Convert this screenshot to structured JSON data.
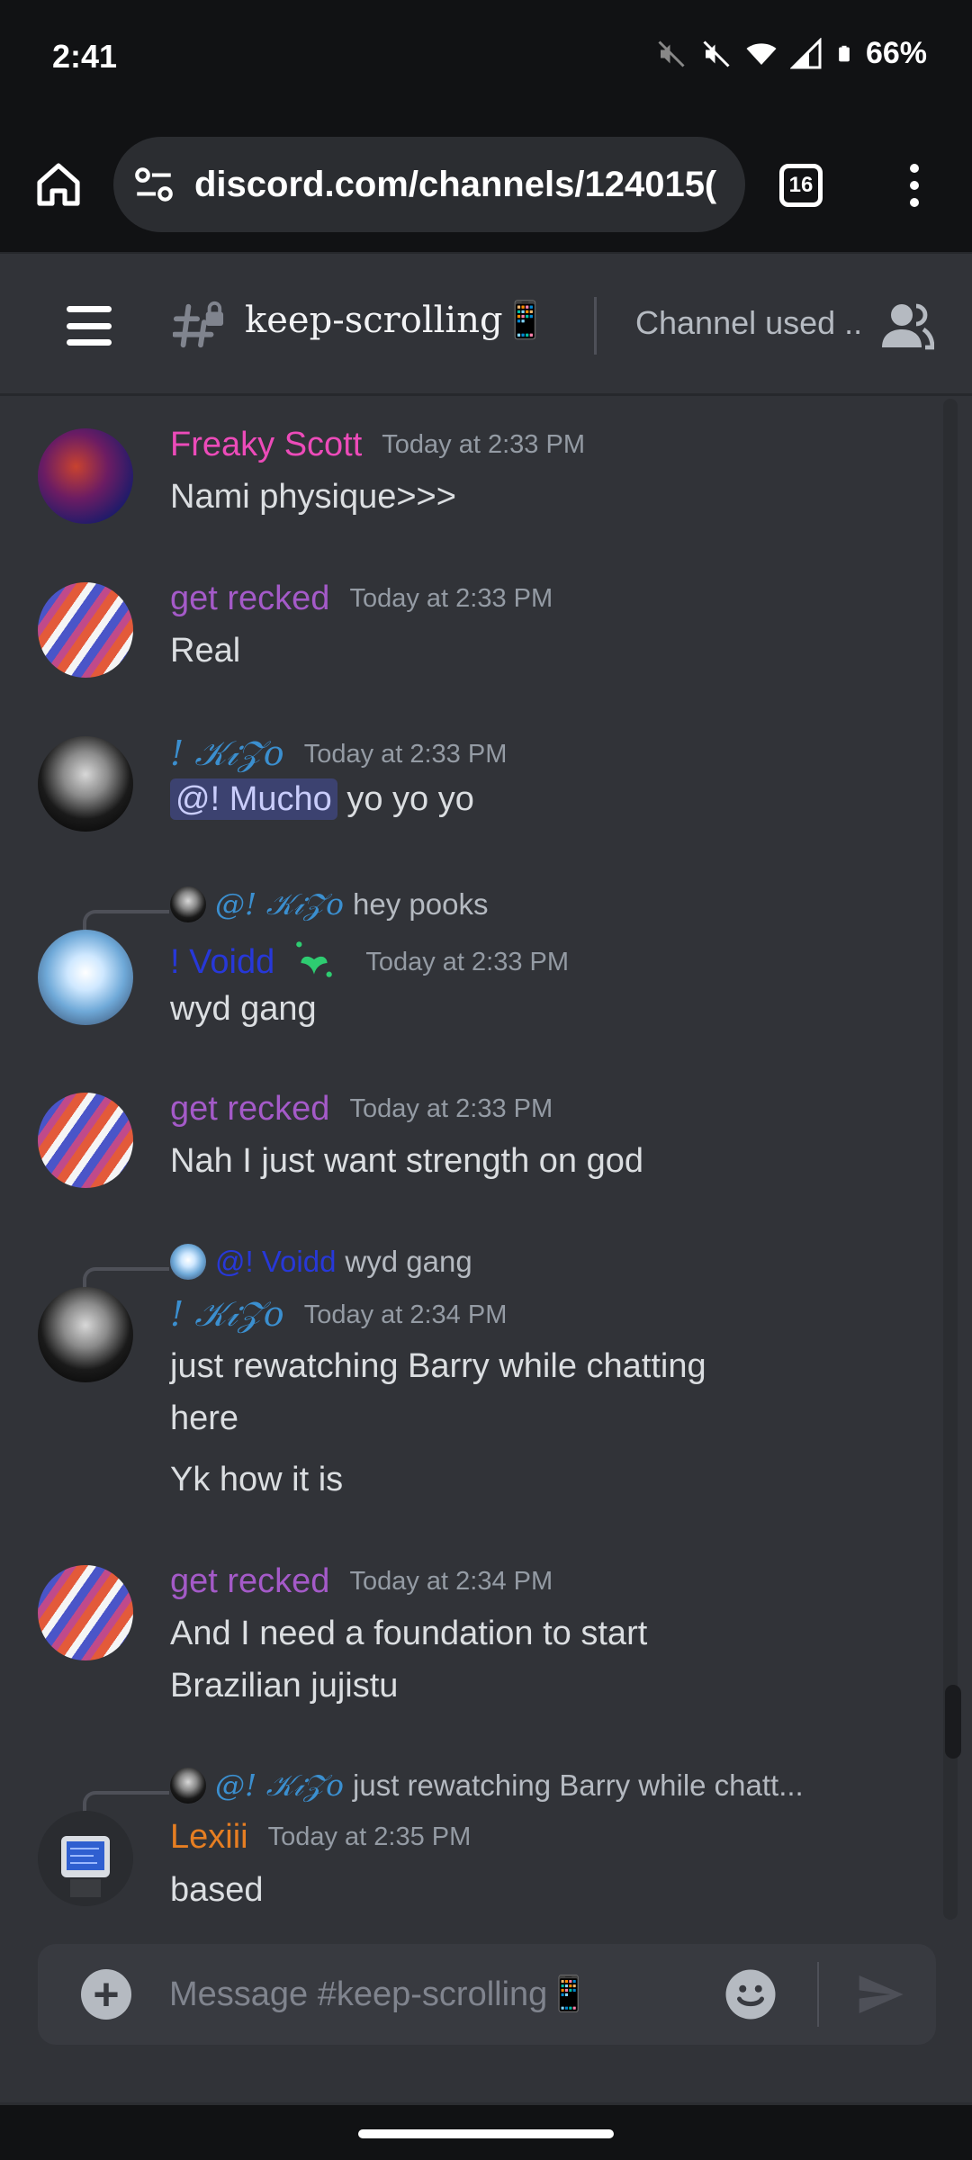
{
  "status_bar": {
    "time": "2:41",
    "battery": "66%"
  },
  "browser": {
    "url": "discord.com/channels/124015(",
    "tab_count": "16"
  },
  "channel": {
    "name": "keep-scrolling📱",
    "topic": "Channel used ..."
  },
  "messages": [
    {
      "author": "Freaky Scott",
      "author_color": "#ec4bb9",
      "timestamp": "Today at 2:33 PM",
      "lines": [
        "Nami physique>>>"
      ]
    },
    {
      "author": "get recked",
      "author_color": "#a45ac8",
      "timestamp": "Today at 2:33 PM",
      "lines": [
        "Real"
      ]
    },
    {
      "author": "! 𝒦𝒾𝒵𝑜",
      "author_color": "#3b8fcf",
      "timestamp": "Today at 2:33 PM",
      "mention": "@! Mucho",
      "lines": [
        "yo yo yo"
      ]
    },
    {
      "reply_to": "@! 𝒦𝒾𝒵𝑜",
      "reply_color": "#3b8fcf",
      "reply_text": "hey pooks",
      "author": "! Voidd",
      "author_color": "#2738d8",
      "timestamp": "Today at 2:33 PM",
      "lines": [
        "wyd gang"
      ]
    },
    {
      "author": "get recked",
      "author_color": "#a45ac8",
      "timestamp": "Today at 2:33 PM",
      "lines": [
        "Nah I just want strength on god"
      ]
    },
    {
      "reply_to": "@! Voidd",
      "reply_color": "#2738d8",
      "reply_text": "wyd gang",
      "author": "! 𝒦𝒾𝒵𝑜",
      "author_color": "#3b8fcf",
      "timestamp": "Today at 2:34 PM",
      "lines": [
        "just rewatching Barry while chatting",
        "here",
        "Yk how it is"
      ]
    },
    {
      "author": "get recked",
      "author_color": "#a45ac8",
      "timestamp": "Today at 2:34 PM",
      "lines": [
        "And I need a foundation to start",
        "Brazilian jujistu"
      ]
    },
    {
      "reply_to": "@! 𝒦𝒾𝒵𝑜",
      "reply_color": "#3b8fcf",
      "reply_text": "just rewatching Barry while chatt...",
      "author": "Lexiii",
      "author_color": "#e67e22",
      "timestamp": "Today at 2:35 PM",
      "lines": [
        "based"
      ]
    }
  ],
  "composer": {
    "placeholder": "Message #keep-scrolling📱"
  },
  "icons": {
    "home": "home-icon",
    "site_settings": "site-settings-icon",
    "tabs": "tabs-icon",
    "overflow": "more-vert-icon",
    "hamburger": "hamburger-icon",
    "locked_channel": "locked-hash-icon",
    "members": "members-icon",
    "add": "plus-icon",
    "emoji": "emoji-icon",
    "send": "send-icon"
  }
}
